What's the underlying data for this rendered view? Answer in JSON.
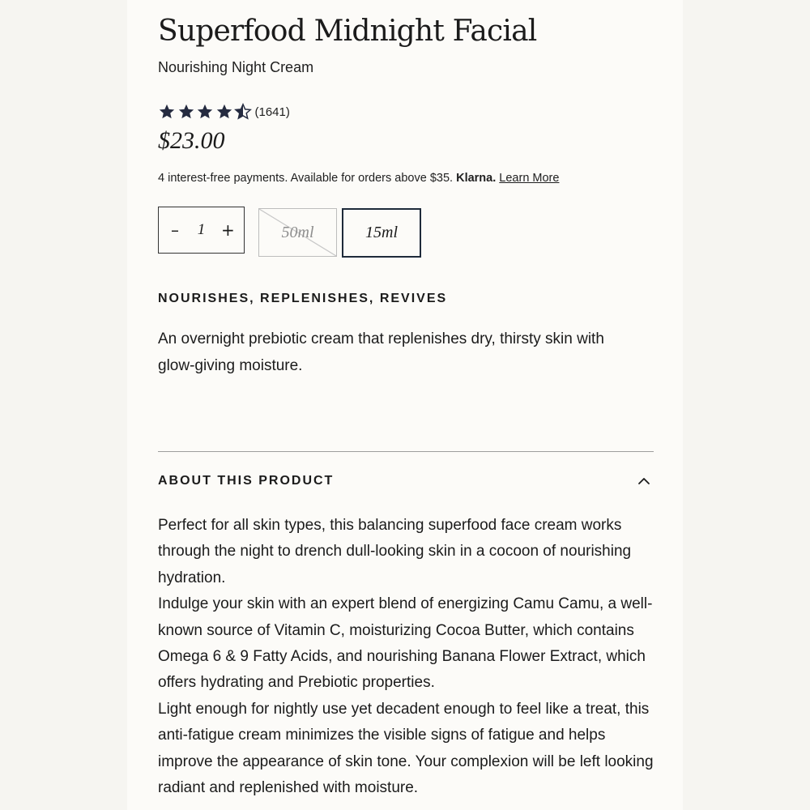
{
  "product": {
    "title": "Superfood Midnight Facial",
    "subtitle": "Nourishing Night Cream",
    "rating": {
      "stars": 4.5,
      "count_text": "(1641)"
    },
    "price": "$23.00"
  },
  "klarna": {
    "text": "4 interest-free payments. Available for orders above $35.",
    "brand": "Klarna.",
    "link_label": "Learn More"
  },
  "quantity": {
    "minus": "–",
    "value": "1",
    "plus": "+"
  },
  "sizes": [
    {
      "label": "50ml",
      "available": false,
      "selected": false
    },
    {
      "label": "15ml",
      "available": true,
      "selected": true
    }
  ],
  "benefits": {
    "heading": "NOURISHES, REPLENISHES, REVIVES",
    "text": "An overnight prebiotic cream that replenishes dry, thirsty skin with glow-giving moisture."
  },
  "about": {
    "title": "ABOUT THIS PRODUCT",
    "expanded": true,
    "paragraphs": [
      "Perfect for all skin types, this balancing superfood face cream works through the night to drench dull-looking skin in a cocoon of nourishing hydration.",
      "Indulge your skin with an expert blend of energizing Camu Camu, a well-known source of Vitamin C, moisturizing Cocoa Butter, which contains Omega 6 & 9 Fatty Acids, and nourishing Banana Flower Extract, which offers hydrating and Prebiotic properties.",
      "Light enough for nightly use yet decadent enough to feel like a treat, this anti-fatigue cream minimizes the visible signs of fatigue and helps improve the appearance of skin tone. Your complexion will be left looking radiant and replenished with moisture."
    ]
  },
  "colors": {
    "star": "#252b40",
    "selected_border": "#1e2a3a",
    "text": "#1b1b1b",
    "page_bg": "#fcfbf8",
    "outer_bg": "#f6f5f1"
  },
  "icons": {
    "star": "star-icon",
    "half_star": "half-star-icon",
    "collapse": "chevron-up-icon"
  }
}
